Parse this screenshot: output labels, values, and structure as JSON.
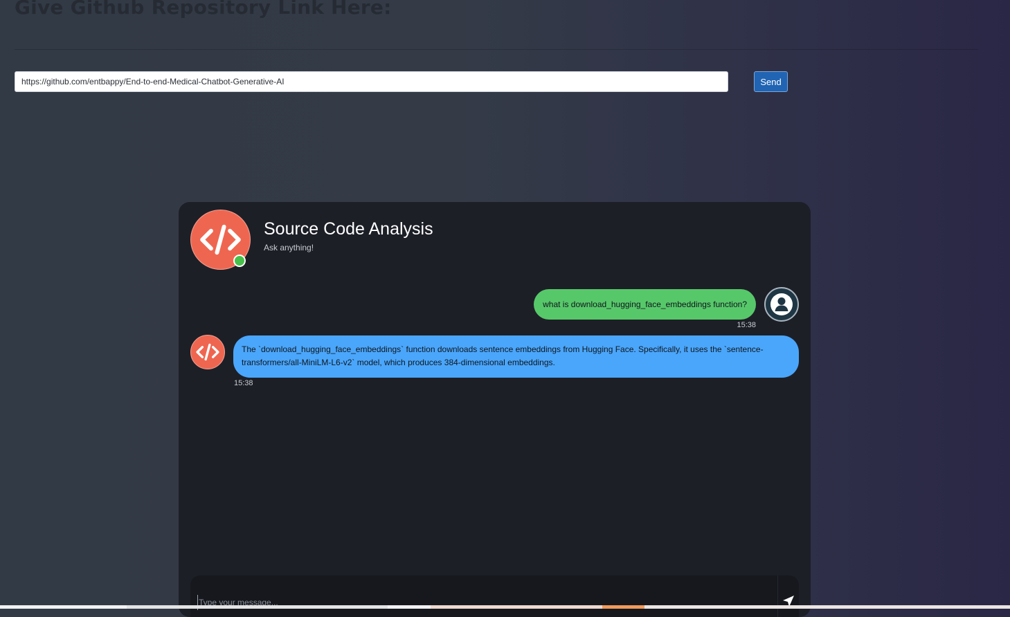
{
  "page": {
    "heading": "Give Github Repository Link Here:"
  },
  "repo_form": {
    "url_value": "https://github.com/entbappy/End-to-end-Medical-Chatbot-Generative-AI",
    "send_label": "Send"
  },
  "chat": {
    "title": "Source Code Analysis",
    "subtitle": "Ask anything!",
    "bot_icon": "code-icon",
    "user_icon": "user-icon",
    "status": "online",
    "messages": [
      {
        "sender": "user",
        "text": "what is download_hugging_face_embeddings function?",
        "time": "15:38"
      },
      {
        "sender": "bot",
        "text": "The `download_hugging_face_embeddings` function downloads sentence embeddings from Hugging Face. Specifically, it uses the `sentence-transformers/all-MiniLM-L6-v2` model, which produces 384-dimensional embeddings.",
        "time": "15:38"
      }
    ],
    "composer": {
      "placeholder": "Type your message...",
      "send_icon": "send-icon"
    }
  },
  "colors": {
    "bot_accent": "#ef6650",
    "user_bubble": "#57c86a",
    "bot_bubble": "#4aa6fb",
    "online_dot": "#47c14b",
    "send_button": "#2064b3"
  }
}
